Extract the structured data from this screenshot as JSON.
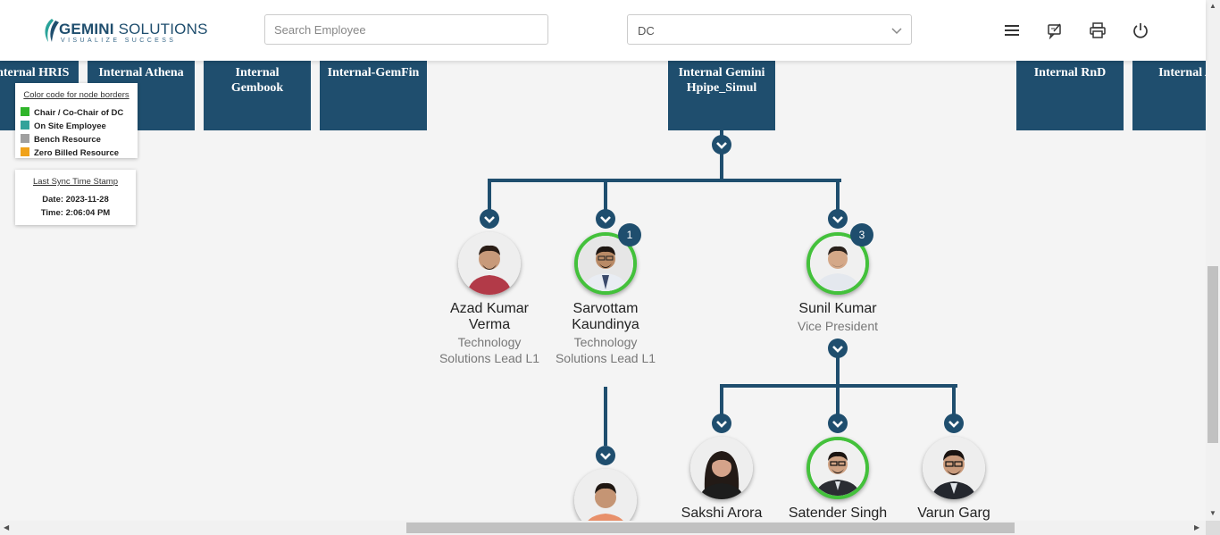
{
  "header": {
    "logo_brand_bold": "GEMINI",
    "logo_brand_rest": " SOLUTIONS",
    "logo_tagline": "VISUALIZE SUCCESS",
    "search_placeholder": "Search Employee",
    "department_selected": "DC",
    "icons": [
      "menu-icon",
      "feedback-icon",
      "print-icon",
      "power-icon"
    ]
  },
  "project_tiles": [
    {
      "line1": "Internal HRIS",
      "line2": ""
    },
    {
      "line1": "Internal Athena",
      "line2": ""
    },
    {
      "line1": "Internal",
      "line2": "Gembook"
    },
    {
      "line1": "Internal-GemFin",
      "line2": ""
    },
    {
      "line1": "Internal Gemini",
      "line2": "Hpipe_Simul"
    },
    {
      "line1": "Internal RnD",
      "line2": ""
    },
    {
      "line1": "Internal A",
      "line2": ""
    }
  ],
  "legend": {
    "title": "Color code for node borders",
    "items": [
      {
        "label": "Chair / Co-Chair of DC",
        "color": "#2fb52a"
      },
      {
        "label": "On Site Employee",
        "color": "#33a39a"
      },
      {
        "label": "Bench Resource",
        "color": "#a0a0a0"
      },
      {
        "label": "Zero Billed Resource",
        "color": "#f0a21a"
      }
    ]
  },
  "sync": {
    "title": "Last Sync Time Stamp",
    "date": "Date: 2023-11-28",
    "time": "Time: 2:06:04 PM"
  },
  "people": [
    {
      "name_line1": "Azad Kumar",
      "name_line2": "Verma",
      "title_line1": "Technology",
      "title_line2": "Solutions Lead L1"
    },
    {
      "name_line1": "Sarvottam",
      "name_line2": "Kaundinya",
      "title_line1": "Technology",
      "title_line2": "Solutions Lead L1",
      "reports": "1"
    },
    {
      "name_line1": "Sunil Kumar",
      "title_line1": "Vice President",
      "reports": "3"
    },
    {
      "name_line1": "Sakshi Arora"
    },
    {
      "name_line1": "Satender Singh"
    },
    {
      "name_line1": "Varun Garg"
    }
  ],
  "colors": {
    "primary": "#1f4e6e",
    "chair_border": "#43c13b"
  }
}
